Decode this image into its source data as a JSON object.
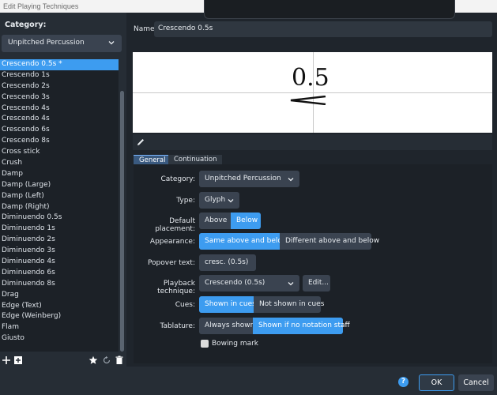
{
  "window": {
    "title": "Edit Playing Techniques"
  },
  "sidebar": {
    "category_label": "Category:",
    "category_value": "Unpitched Percussion",
    "items": [
      "Crescendo 0.5s *",
      "Crescendo 1s",
      "Crescendo 2s",
      "Crescendo 3s",
      "Crescendo 4s",
      "Crescendo 4s",
      "Crescendo 6s",
      "Crescendo 8s",
      "Cross stick",
      "Crush",
      "Damp",
      "Damp (Large)",
      "Damp (Left)",
      "Damp (Right)",
      "Diminuendo 0.5s",
      "Diminuendo 1s",
      "Diminuendo 2s",
      "Diminuendo 3s",
      "Diminuendo 4s",
      "Diminuendo 6s",
      "Diminuendo 8s",
      "Drag",
      "Edge (Text)",
      "Edge (Weinberg)",
      "Flam",
      "Giusto"
    ],
    "selected_index": 0
  },
  "name": {
    "label": "Name:",
    "value": "Crescendo 0.5s"
  },
  "preview": {
    "text": "0.5"
  },
  "tabs": [
    {
      "label": "General"
    },
    {
      "label": "Continuation"
    }
  ],
  "form": {
    "category": {
      "label": "Category:",
      "value": "Unpitched Percussion"
    },
    "type": {
      "label": "Type:",
      "value": "Glyph"
    },
    "placement": {
      "label": "Default placement:",
      "above": "Above",
      "below": "Below"
    },
    "appearance": {
      "label": "Appearance:",
      "same": "Same above and below",
      "different": "Different above and below"
    },
    "popover": {
      "label": "Popover text:",
      "value": "cresc. (0.5s)"
    },
    "playback": {
      "label": "Playback technique:",
      "value": "Crescendo (0.5s)",
      "edit": "Edit..."
    },
    "cues": {
      "label": "Cues:",
      "shown": "Shown in cues",
      "not_shown": "Not shown in cues"
    },
    "tablature": {
      "label": "Tablature:",
      "always": "Always shown",
      "if_no": "Shown if no notation staff"
    },
    "bowing": {
      "label": "Bowing mark"
    }
  },
  "buttons": {
    "help": "?",
    "ok": "OK",
    "cancel": "Cancel"
  },
  "colors": {
    "accent": "#3d9cf0",
    "panel": "#262d35",
    "field": "#3a4350"
  }
}
